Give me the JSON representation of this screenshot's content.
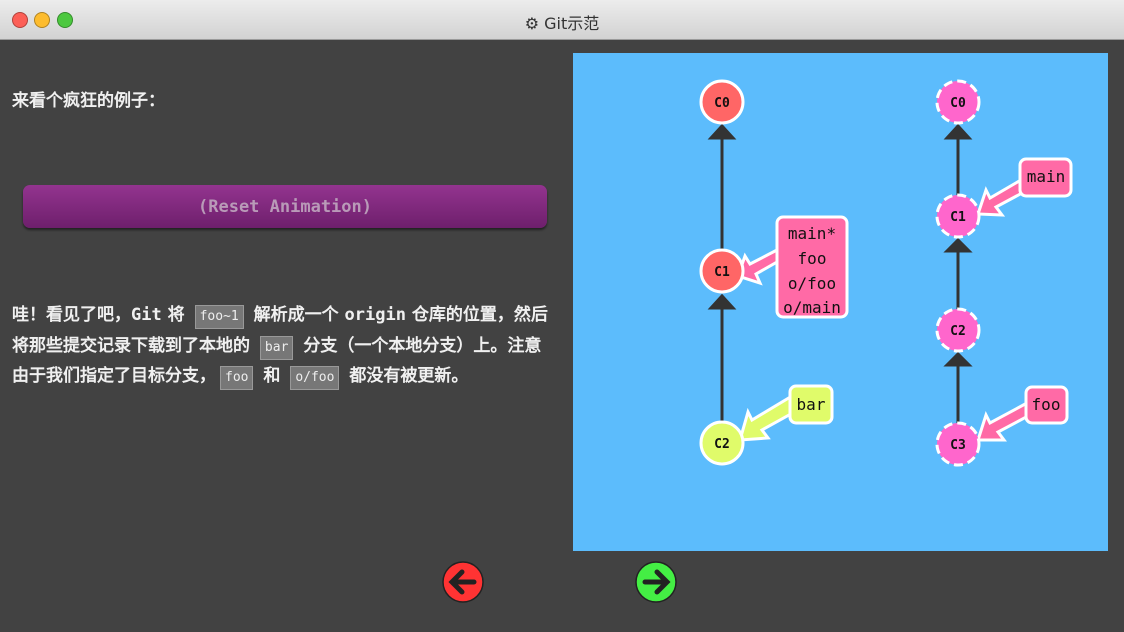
{
  "window": {
    "title": "Git示范",
    "icon": "gear-icon",
    "controls": [
      "close",
      "minimize",
      "maximize"
    ]
  },
  "intro": "来看个疯狂的例子：",
  "reset_label": "(Reset Animation)",
  "explanation": {
    "t1": "哇！看见了吧，",
    "t2": "Git",
    "t3": " 将 ",
    "c1": "foo~1",
    "t4": " 解析成一个 ",
    "t5": "origin",
    "t6": " 仓库的位置，然后将那些提交记录下载到了本地的 ",
    "c2": "bar",
    "t7": " 分支（一个本地分支）上。注意由于我们指定了目标分支，",
    "c3": "foo",
    "t8": " 和 ",
    "c4": "o/foo",
    "t9": " 都没有被更新。"
  },
  "local": {
    "commits": [
      "C0",
      "C1",
      "C2"
    ],
    "labels": {
      "c1": [
        "main*",
        "foo",
        "o/foo",
        "o/main"
      ],
      "c2": "bar"
    }
  },
  "remote": {
    "commits": [
      "C0",
      "C1",
      "C2",
      "C3"
    ],
    "labels": {
      "c1": "main",
      "c3": "foo"
    }
  },
  "colors": {
    "canvas": "#5cbcfc",
    "local_commit": "#ff6666",
    "branch_pink": "#ff6aa6",
    "bar_branch": "#e0fb6a",
    "remote_commit": "#ff66cc",
    "prev": "#ff3333",
    "next": "#44ee44"
  },
  "nav": {
    "prev": "arrow-left-icon",
    "next": "arrow-right-icon"
  }
}
